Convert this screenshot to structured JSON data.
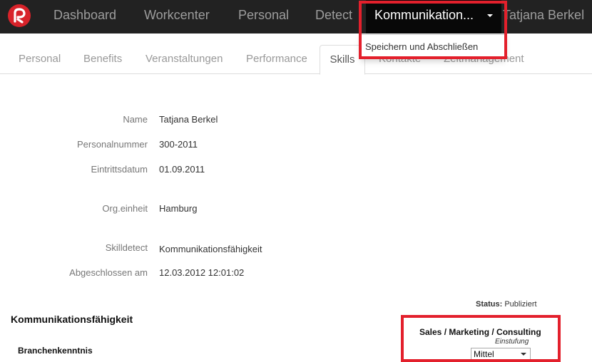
{
  "navbar": {
    "items": [
      "Dashboard",
      "Workcenter",
      "Personal",
      "Detect"
    ],
    "active_item": "Kommunikation...",
    "user_name": "Tatjana Berkel"
  },
  "dropdown": {
    "items": [
      "Speichern und Abschließen"
    ]
  },
  "tabs": [
    "Personal",
    "Benefits",
    "Veranstaltungen",
    "Performance",
    "Skills",
    "Kontakte",
    "Zeitmanagement"
  ],
  "active_tab": "Skills",
  "details": {
    "name_label": "Name",
    "name_value": "Tatjana Berkel",
    "personalnummer_label": "Personalnummer",
    "personalnummer_value": "300-2011",
    "eintrittsdatum_label": "Eintrittsdatum",
    "eintrittsdatum_value": "01.09.2011",
    "orgeinheit_label": "Org.einheit",
    "orgeinheit_value": "Hamburg",
    "skilldetect_label": "Skilldetect",
    "skilldetect_value": "Kommunikationsfähigkeit",
    "abgeschlossen_label": "Abgeschlossen am",
    "abgeschlossen_value": "12.03.2012 12:01:02"
  },
  "status": {
    "label": "Status:",
    "value": "Publiziert"
  },
  "skill_section": {
    "title": "Kommunikationsfähigkeit",
    "subtitle": "Branchenkenntnis",
    "column_header": "Sales / Marketing / Consulting",
    "column_subheader": "Einstufung",
    "selected_level": "Mittel"
  },
  "colors": {
    "highlight": "#e3202c",
    "navbar_bg": "#222222",
    "logo": "#d8232a"
  }
}
